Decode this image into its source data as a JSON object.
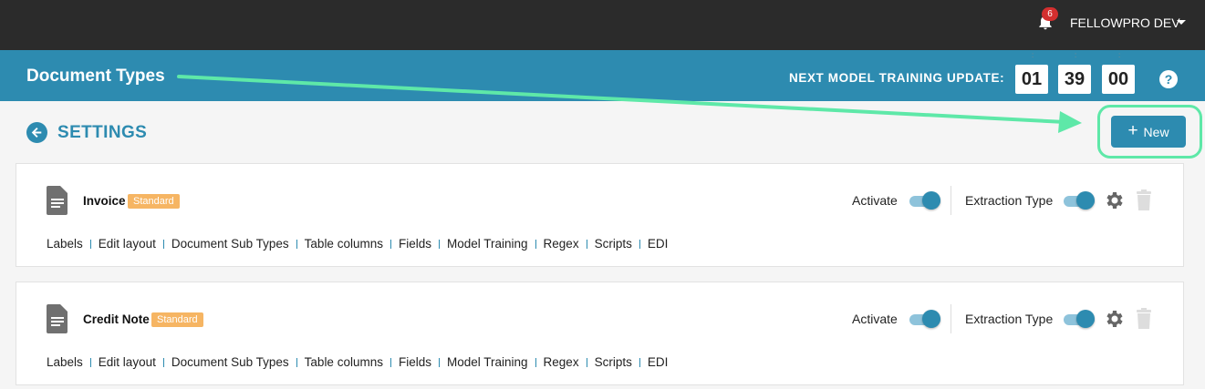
{
  "topbar": {
    "notification_count": "6",
    "user_name": "FELLOWPRO DEV"
  },
  "header": {
    "title": "Document Types",
    "training_label": "NEXT MODEL TRAINING UPDATE:",
    "hours": "01",
    "minutes": "39",
    "seconds": "00"
  },
  "page": {
    "back_label": "SETTINGS",
    "new_button": "New"
  },
  "colors": {
    "accent": "#2d8bb0",
    "highlight": "#5ee8a8",
    "badge": "#f6b563"
  },
  "document_types": [
    {
      "name": "Invoice",
      "badge": "Standard",
      "activate_label": "Activate",
      "extraction_label": "Extraction Type",
      "links": [
        "Labels",
        "Edit layout",
        "Document Sub Types",
        "Table columns",
        "Fields",
        "Model Training",
        "Regex",
        "Scripts",
        "EDI"
      ]
    },
    {
      "name": "Credit Note",
      "badge": "Standard",
      "activate_label": "Activate",
      "extraction_label": "Extraction Type",
      "links": [
        "Labels",
        "Edit layout",
        "Document Sub Types",
        "Table columns",
        "Fields",
        "Model Training",
        "Regex",
        "Scripts",
        "EDI"
      ]
    }
  ]
}
